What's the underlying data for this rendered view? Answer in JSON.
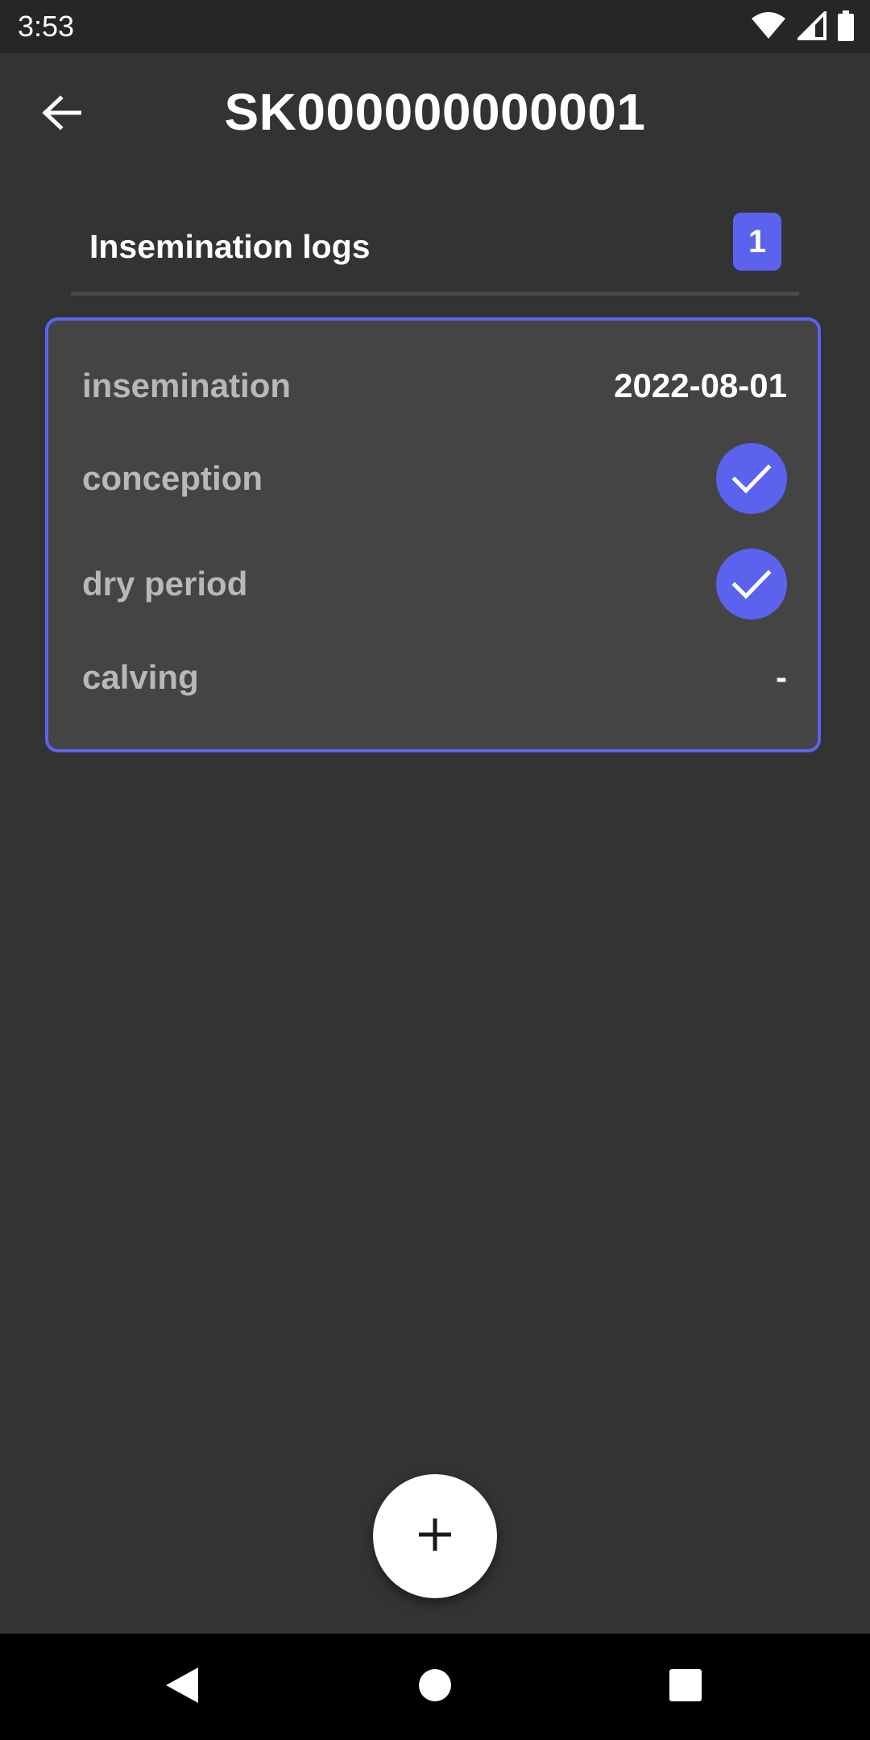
{
  "status_bar": {
    "time": "3:53",
    "icons": [
      "wifi-icon",
      "cellular-signal-icon",
      "battery-icon"
    ]
  },
  "header": {
    "title": "SK000000000001",
    "back_icon": "arrow-left-icon"
  },
  "section": {
    "title": "Insemination logs",
    "count": "1"
  },
  "log": {
    "rows": [
      {
        "label": "insemination",
        "value": "2022-08-01"
      },
      {
        "label": "conception",
        "checked": true
      },
      {
        "label": "dry period",
        "checked": true
      },
      {
        "label": "calving",
        "value": "-"
      }
    ]
  },
  "fab": {
    "icon": "plus-icon"
  },
  "navigation": {
    "icons": [
      "back-triangle-icon",
      "home-circle-icon",
      "recents-square-icon"
    ]
  },
  "colors": {
    "background": "#333333",
    "card_background": "#444444",
    "accent": "#5b63ee",
    "status_bar": "#262626",
    "nav_bar": "#000000",
    "label_text": "#b8b8b8"
  }
}
